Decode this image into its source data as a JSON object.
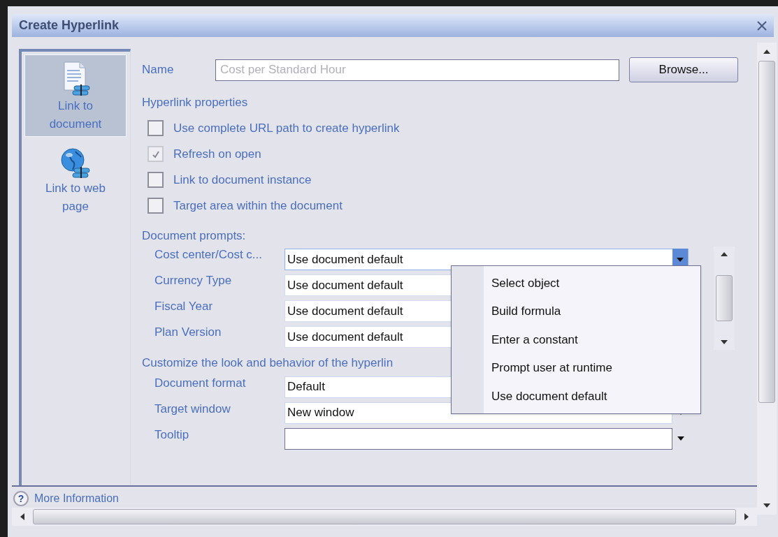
{
  "window": {
    "title": "Create Hyperlink"
  },
  "sidebar": {
    "items": [
      {
        "label": "Link to document",
        "kind": "document",
        "selected": true
      },
      {
        "label": "Link to web page",
        "kind": "web",
        "selected": false
      }
    ]
  },
  "name_field": {
    "label": "Name",
    "value": "Cost per Standard Hour",
    "disabled": true
  },
  "browse_button": "Browse...",
  "hyperlink_properties": {
    "heading": "Hyperlink properties",
    "options": [
      {
        "label": "Use complete URL path to create hyperlink",
        "checked": false,
        "disabled": false
      },
      {
        "label": "Refresh on open",
        "checked": true,
        "disabled": true
      },
      {
        "label": "Link to document instance",
        "checked": false,
        "disabled": false
      },
      {
        "label": "Target area within the document",
        "checked": false,
        "disabled": false
      }
    ]
  },
  "document_prompts": {
    "heading": "Document prompts:",
    "prompts": [
      {
        "label": "Cost center/Cost c...",
        "value": "Use document default",
        "open": true
      },
      {
        "label": "Currency Type",
        "value": "Use document default",
        "open": false
      },
      {
        "label": "Fiscal Year",
        "value": "Use document default",
        "open": false
      },
      {
        "label": "Plan Version",
        "value": "Use document default",
        "open": false
      }
    ]
  },
  "dropdown_menu": {
    "items": [
      "Select object",
      "Build formula",
      "Enter a constant",
      "Prompt user at runtime",
      "Use document default"
    ]
  },
  "customize": {
    "heading": "Customize the look and behavior of the hyperlin",
    "fields": [
      {
        "label": "Document format",
        "value": "Default"
      },
      {
        "label": "Target window",
        "value": "New window"
      },
      {
        "label": "Tooltip"
      }
    ]
  },
  "help_icon": "?",
  "more_information": "More Information"
}
